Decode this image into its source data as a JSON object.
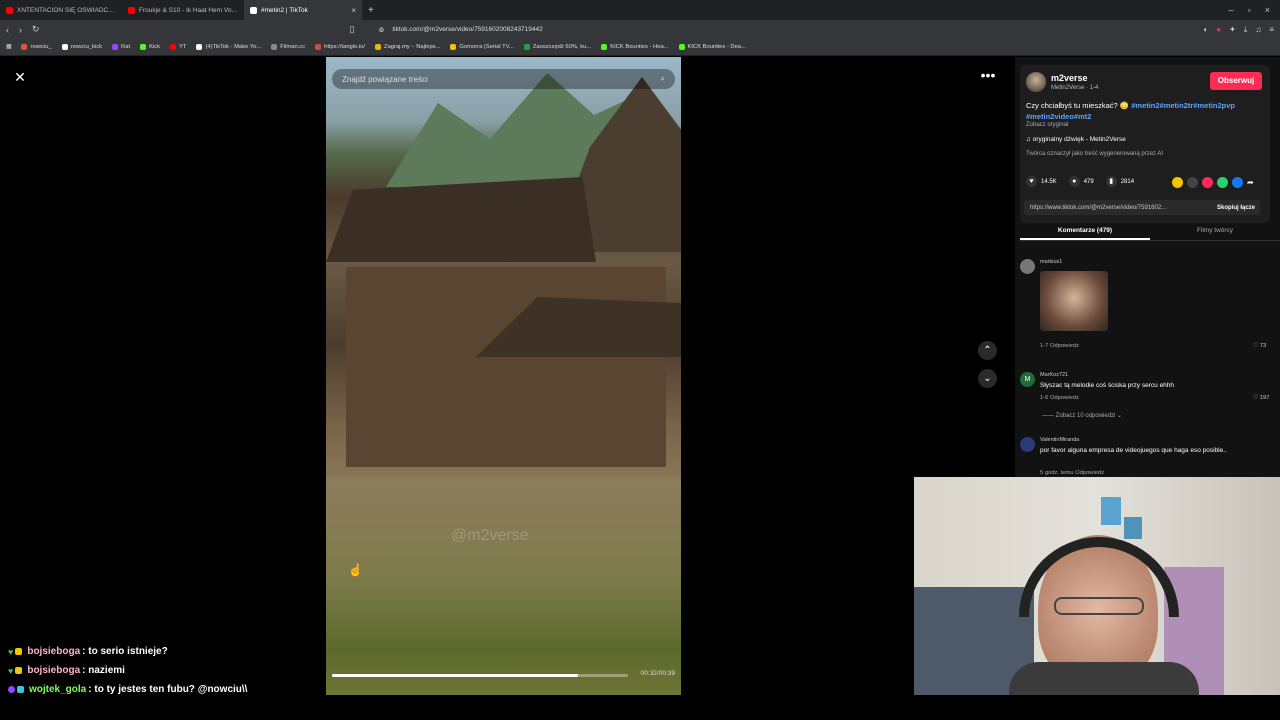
{
  "browser": {
    "tabs": [
      {
        "label": "XNTENTACION SIĘ OŚWIADCZYŁ! O",
        "active": false,
        "icon_color": "#ff0000"
      },
      {
        "label": "Froukje & S10 - Ik Haat Hem Voor Je",
        "active": false,
        "icon_color": "#ff0000"
      },
      {
        "label": "#metin2 | TikTok",
        "active": true,
        "icon_color": "#ffffff"
      }
    ],
    "new_tab": "+",
    "url": "tiktok.com/@m2verse/video/7591602008243719442",
    "bookmarks": [
      "nowciu_",
      "nowciu_kick",
      "Rat",
      "Kick",
      "YT",
      "(4)TikTok - Make Yo...",
      "Filman.cc",
      "https://tangle.io/",
      "Zagraj.my – Najleps...",
      "Gomorra (Serial TV...",
      "Zaoszczędź 60%, ku...",
      "KICK Bounties - Hea...",
      "KICK Bounties - Dea..."
    ]
  },
  "video": {
    "search_placeholder": "Znajdź powiązane treści",
    "watermark": "@m2verse",
    "time": "00:32/00:39",
    "progress": 0.83
  },
  "panel": {
    "username": "m2verse",
    "subtitle": "Metin2Verse · 1-4",
    "follow_label": "Obserwuj",
    "desc_text": "Czy chciałbyś tu mieszkać? 😳 ",
    "desc_tags": "#metin2#metin2tr#metin2pvp #metin2video#mt2",
    "see_original": "Zobacz oryginał",
    "sound": "♫  oryginalny dźwięk - Metin2Verse",
    "ai_info": "Twórca oznaczył jako treść wygenerowaną przez AI",
    "likes": "14.5K",
    "comments_count": "479",
    "saves": "2814",
    "link": "https://www.tiktok.com/@m2verse/video/7591602...",
    "copy_link": "Skopiuj łącze",
    "tab_comments": "Komentarze (479)",
    "tab_creator_videos": "Filmy twórcy"
  },
  "comments": [
    {
      "name": "markius1",
      "text": "",
      "meta": "1-7   Odpowiedz",
      "likes": "♡ 73"
    },
    {
      "name": "MarKoz721",
      "text": "Słyszac tą melodie coś ściska przy sercu ehhh",
      "meta": "1-6   Odpowiedz",
      "likes": "♡ 197"
    },
    {
      "name": "ValentinMiranda",
      "text": "por favor alguna empresa de videojuegos que haga eso posible..",
      "meta": "5 godz. temu   Odpowiedz",
      "likes": ""
    }
  ],
  "view_replies": "—— Zobacz 10 odpowiedzi ⌄",
  "chat": [
    {
      "user": "bojsieboga",
      "text": ": to serio istnieje?",
      "user_color": "#ffb3c8"
    },
    {
      "user": "bojsieboga",
      "text": ": naziemi",
      "user_color": "#ffb3c8"
    },
    {
      "user": "wojtek_gola",
      "text": ": to ty jestes ten fubu? @nowciu\\\\",
      "user_color": "#7dff5a"
    }
  ],
  "colors": {
    "accent": "#fe2c55",
    "tag": "#5ea3ff"
  }
}
